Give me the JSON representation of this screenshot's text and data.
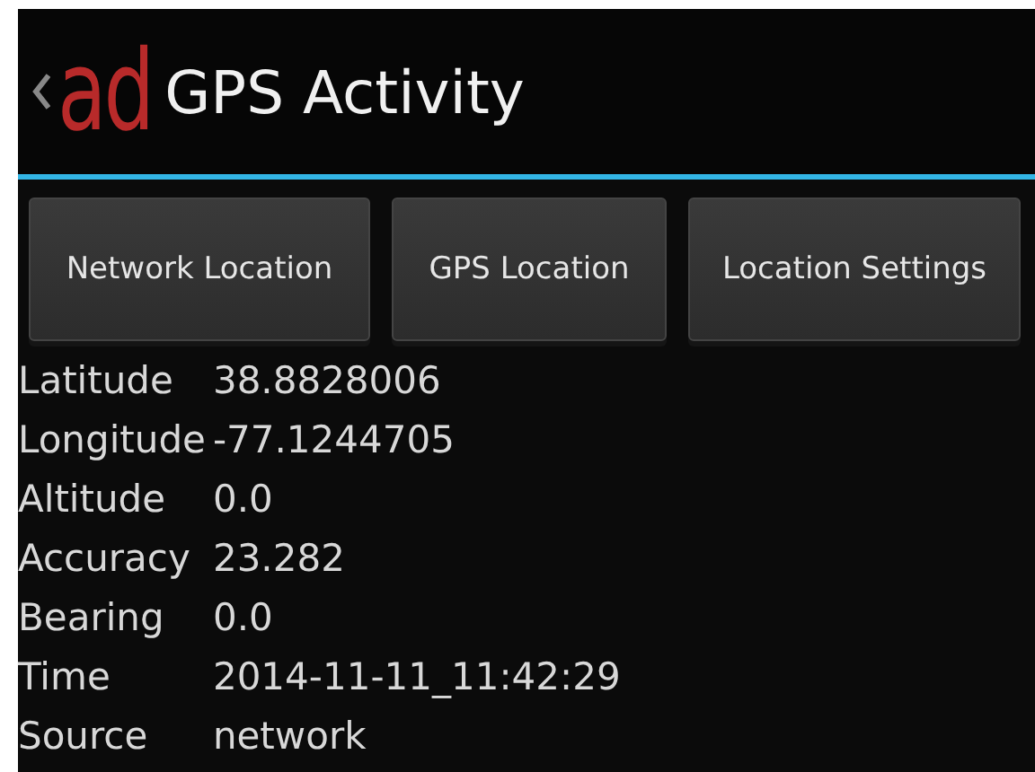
{
  "action_bar": {
    "logo": "ad",
    "title": "GPS Activity"
  },
  "buttons": [
    "Network Location",
    "GPS Location",
    "Location Settings"
  ],
  "fields": [
    {
      "label": "Latitude",
      "value": "38.8828006"
    },
    {
      "label": "Longitude",
      "value": "-77.1244705"
    },
    {
      "label": "Altitude",
      "value": "0.0"
    },
    {
      "label": "Accuracy",
      "value": "23.282"
    },
    {
      "label": "Bearing",
      "value": "0.0"
    },
    {
      "label": "Time",
      "value": "2014-11-11_11:42:29"
    },
    {
      "label": "Source",
      "value": "network"
    }
  ]
}
